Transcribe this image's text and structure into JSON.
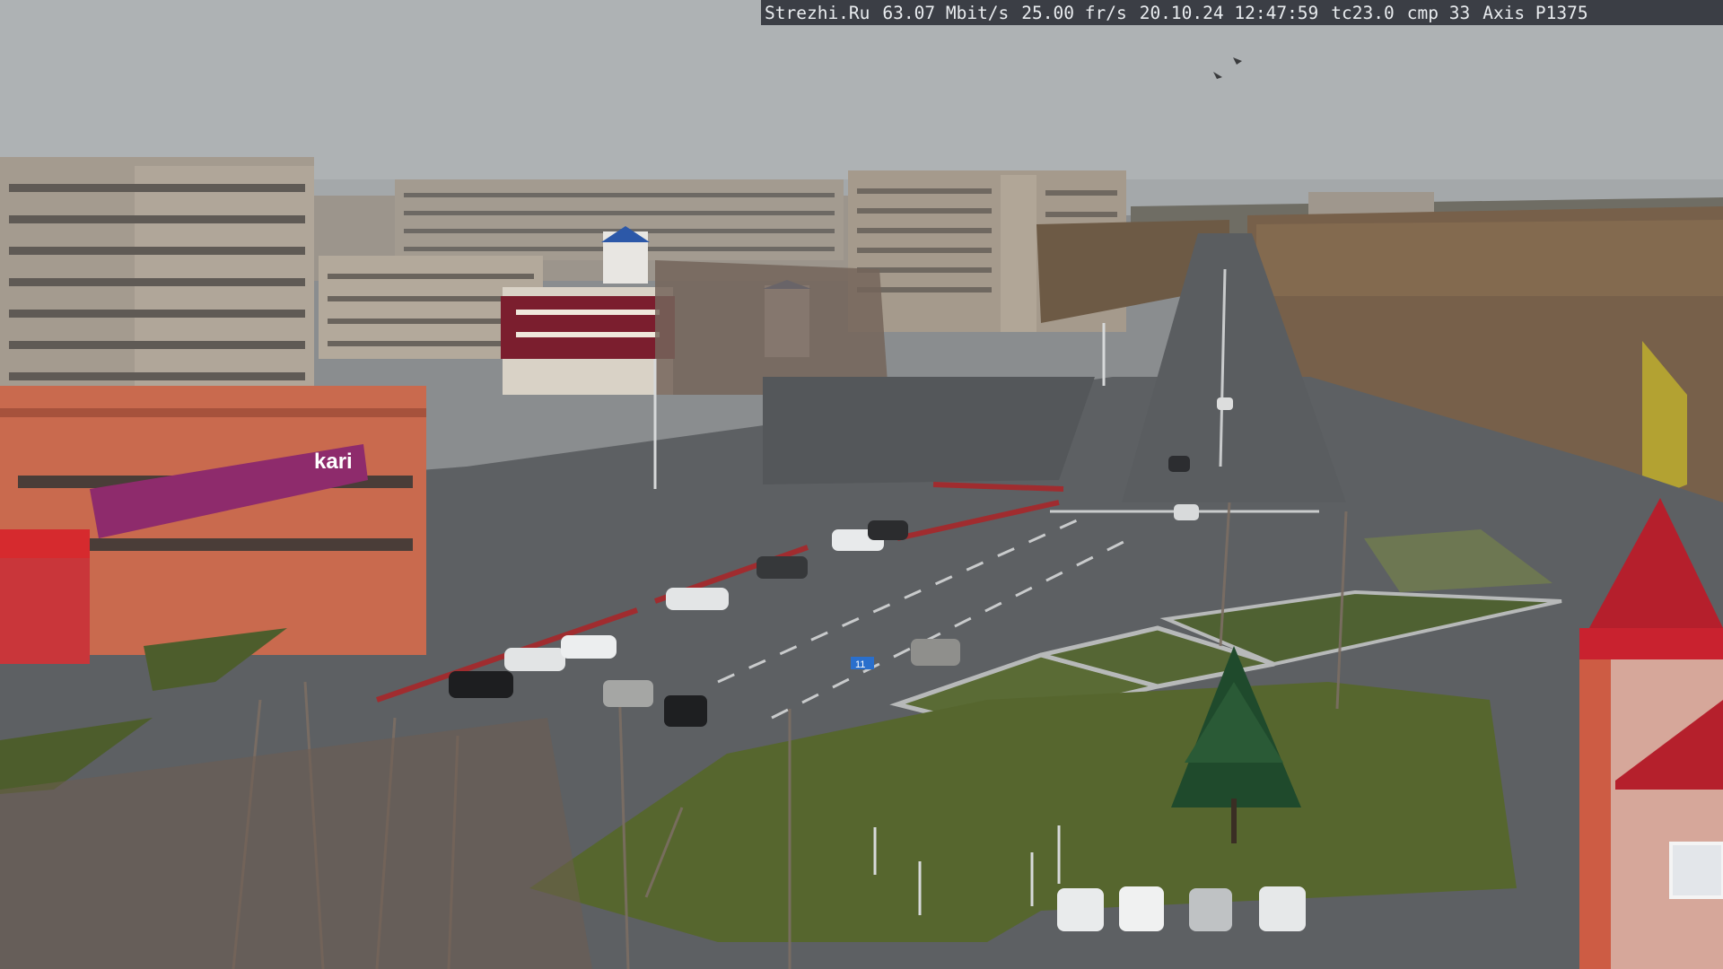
{
  "overlay": {
    "site": "Strezhi.Ru",
    "bitrate": "63.07 Mbit/s",
    "framerate": "25.00 fr/s",
    "datetime": "20.10.24 12:47:59",
    "temperature": "tc23.0",
    "compression": "cmp 33",
    "camera_model": "Axis P1375"
  },
  "signage": {
    "store_logo": "kari",
    "route_sign": "11"
  },
  "colors": {
    "sky": "#aeb2b4",
    "asphalt": "#5d6063",
    "grass": "#56662e",
    "osd_bar": "#3b3e45",
    "store_facade": "#8e2b6c",
    "roof_red": "#b51f2c"
  }
}
